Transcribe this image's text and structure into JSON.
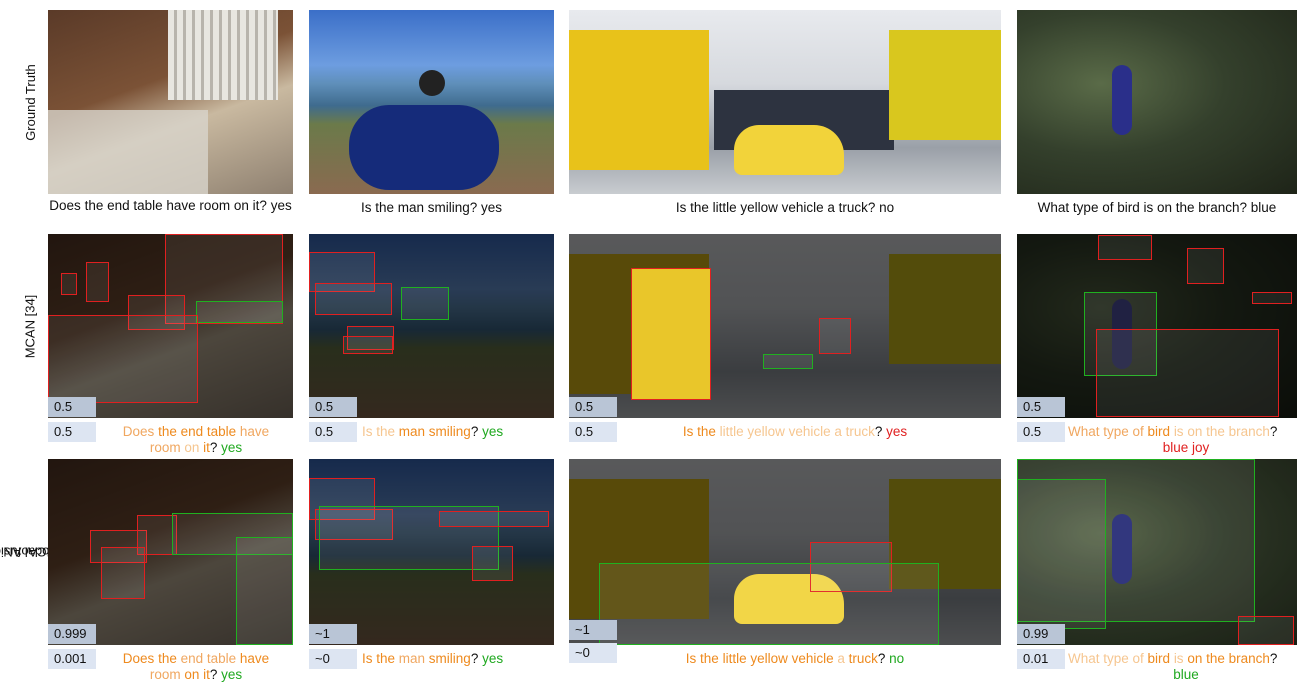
{
  "row_labels": {
    "gt": "Ground Truth",
    "mcan": "MCAN [34]",
    "mcaoan_1": "MCAoAN w/",
    "mcaoan_2": "multimodal fusion"
  },
  "gt_captions": [
    "Does the end table have room on it? yes",
    "Is the man smiling? yes",
    "Is the little yellow vehicle a truck? no",
    "What type of bird is on the branch? blue"
  ],
  "mcan": {
    "scores": [
      {
        "top": "0.5",
        "bottom": "0.5"
      },
      {
        "top": "0.5",
        "bottom": "0.5"
      },
      {
        "top": "0.5",
        "bottom": "0.5"
      },
      {
        "top": "0.5",
        "bottom": "0.5"
      }
    ],
    "q1": {
      "l1": [
        "Does ",
        "the end table ",
        "have"
      ],
      "l2": [
        "room ",
        "on ",
        "it",
        "? ",
        "yes"
      ]
    },
    "q2": [
      "Is the ",
      "man ",
      "smiling",
      "? ",
      "yes"
    ],
    "q3": [
      "Is the ",
      "little yellow vehicle a truck",
      "? ",
      "yes"
    ],
    "q4": {
      "l1": [
        "What type of ",
        "bird ",
        "is on the branch",
        "?"
      ],
      "l2": "blue joy"
    }
  },
  "mcaoan": {
    "scores": [
      {
        "top": "0.999",
        "bottom": "0.001"
      },
      {
        "top": "~1",
        "bottom": "~0"
      },
      {
        "top": "~1",
        "bottom": "~0"
      },
      {
        "top": "0.99",
        "bottom": "0.01"
      }
    ],
    "q1": {
      "l1": [
        "Does the ",
        "end table ",
        "have"
      ],
      "l2": [
        "room ",
        "on it",
        "? ",
        "yes"
      ]
    },
    "q2": [
      "Is the ",
      "man ",
      "smiling",
      "? ",
      "yes"
    ],
    "q3": [
      "Is the little yellow vehicle ",
      "a ",
      "truck",
      "? ",
      "no"
    ],
    "q4": {
      "l1": [
        "What type of ",
        "bird ",
        "is ",
        "on the branch",
        "?"
      ],
      "l2": "blue"
    }
  }
}
